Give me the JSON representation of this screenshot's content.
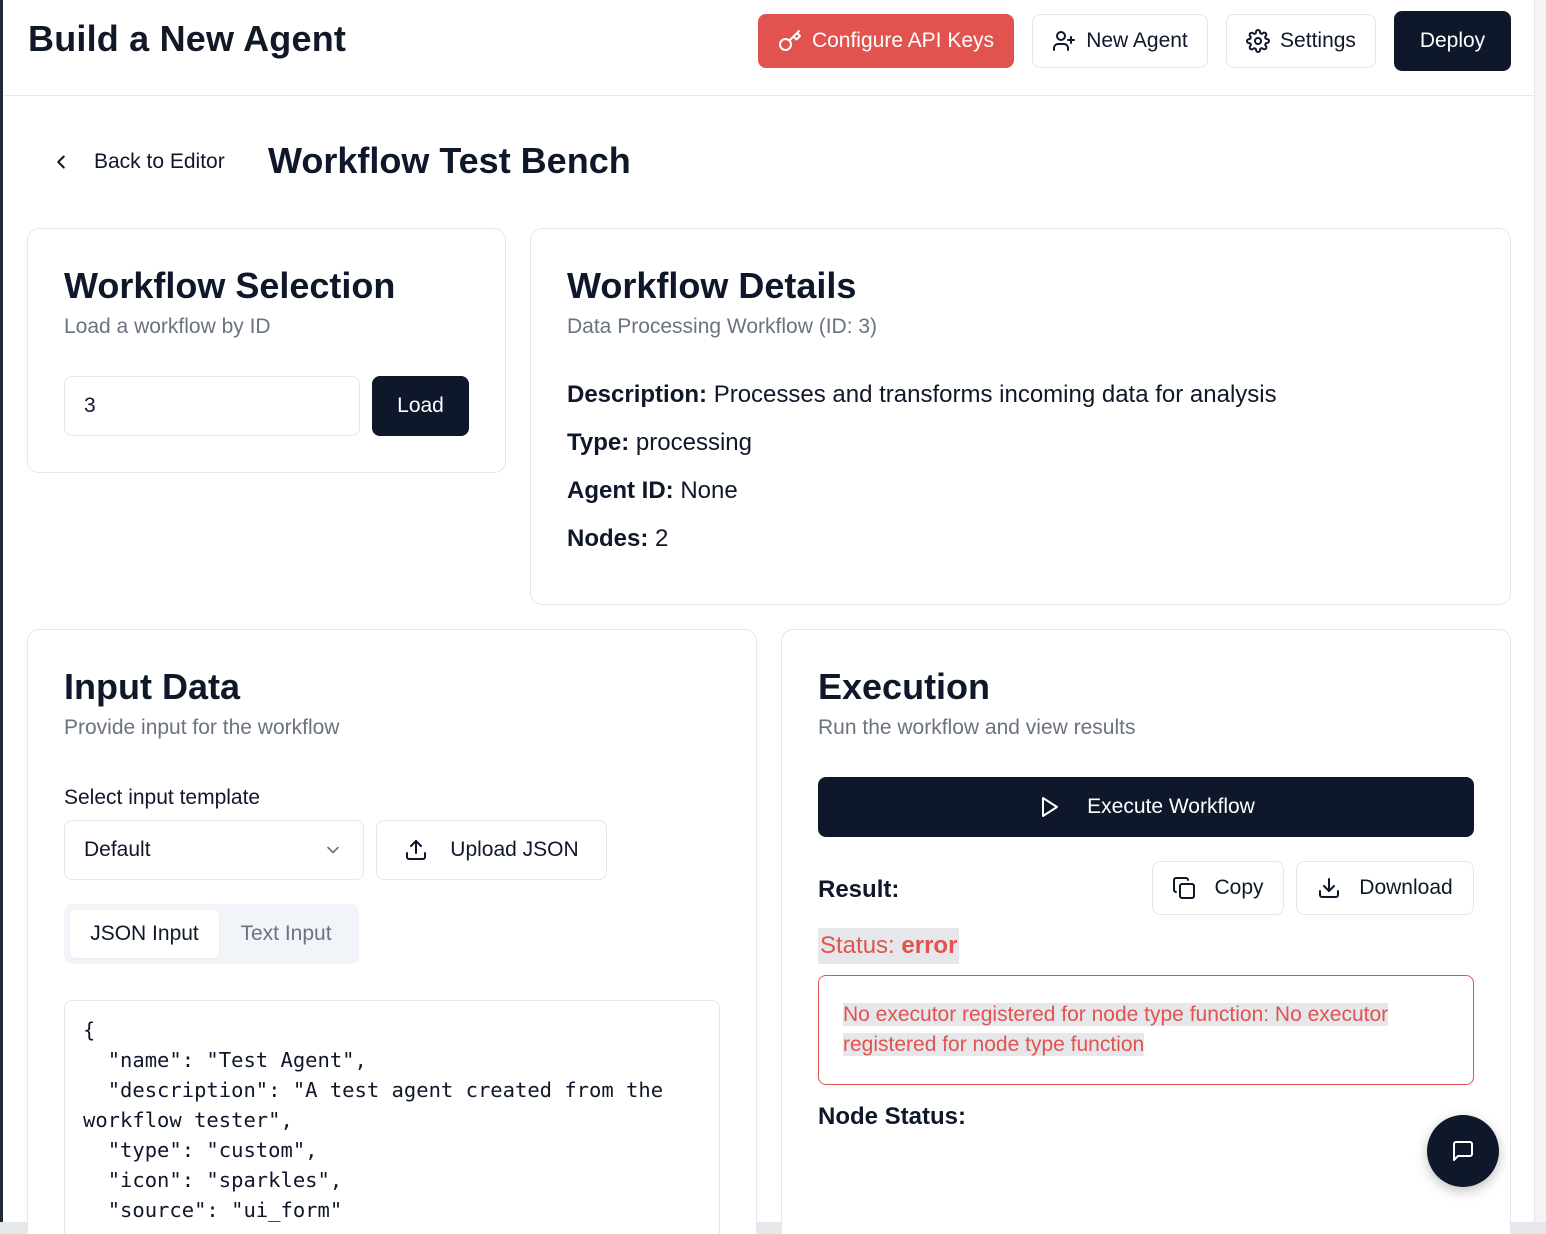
{
  "header": {
    "title": "Build a New Agent",
    "configure_api_keys": "Configure API Keys",
    "new_agent": "New Agent",
    "settings": "Settings",
    "deploy": "Deploy"
  },
  "page": {
    "back_label": "Back to Editor",
    "title": "Workflow Test Bench"
  },
  "workflow_selection": {
    "title": "Workflow Selection",
    "subtitle": "Load a workflow by ID",
    "id_value": "3",
    "load_label": "Load"
  },
  "workflow_details": {
    "title": "Workflow Details",
    "subtitle": "Data Processing Workflow (ID: 3)",
    "fields": [
      {
        "label": "Description:",
        "value": "Processes and transforms incoming data for analysis"
      },
      {
        "label": "Type:",
        "value": "processing"
      },
      {
        "label": "Agent ID:",
        "value": "None"
      },
      {
        "label": "Nodes:",
        "value": "2"
      }
    ]
  },
  "input_data": {
    "title": "Input Data",
    "subtitle": "Provide input for the workflow",
    "template_label": "Select input template",
    "template_value": "Default",
    "upload_label": "Upload JSON",
    "tabs": [
      {
        "label": "JSON Input",
        "active": true
      },
      {
        "label": "Text Input",
        "active": false
      }
    ],
    "json_text": "{\n  \"name\": \"Test Agent\",\n  \"description\": \"A test agent created from the workflow tester\",\n  \"type\": \"custom\",\n  \"icon\": \"sparkles\",\n  \"source\": \"ui_form\""
  },
  "execution": {
    "title": "Execution",
    "subtitle": "Run the workflow and view results",
    "execute_label": "Execute Workflow",
    "result_label": "Result:",
    "copy_label": "Copy",
    "download_label": "Download",
    "status_prefix": "Status: ",
    "status_value": "error",
    "error_message": "No executor registered for node type function: No executor registered for node type function",
    "node_status_label": "Node Status:"
  },
  "icons": {
    "configure_api_keys": "key-icon",
    "new_agent": "user-plus-icon",
    "settings": "gear-icon",
    "back": "chevron-left-icon",
    "dropdown": "chevron-down-icon",
    "upload": "upload-icon",
    "execute": "play-icon",
    "copy": "copy-icon",
    "download": "download-icon",
    "chat": "message-square-icon"
  },
  "colors": {
    "primary_dark": "#0f172a",
    "danger": "#e2534f",
    "muted_text": "#6b7280",
    "border": "#e2e8f0"
  }
}
